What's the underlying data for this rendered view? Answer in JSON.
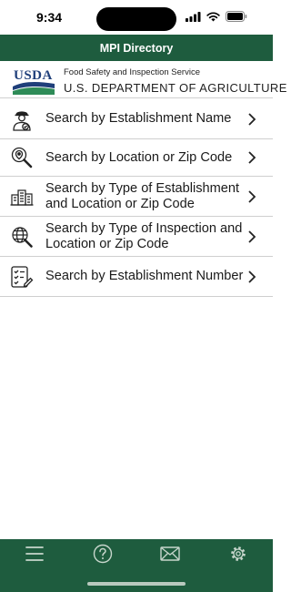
{
  "status_bar": {
    "time": "9:34"
  },
  "nav": {
    "title": "MPI Directory"
  },
  "banner": {
    "logo_text": "USDA",
    "agency": "Food Safety and Inspection Service",
    "department": "U.S. DEPARTMENT OF AGRICULTURE"
  },
  "menu": {
    "items": [
      {
        "label": "Search by Establishment Name",
        "icon": "inspector-icon"
      },
      {
        "label": "Search by Location or Zip Code",
        "icon": "location-search-icon"
      },
      {
        "label": "Search by Type of Establishment and Location or Zip Code",
        "icon": "buildings-icon"
      },
      {
        "label": "Search by Type of Inspection and Location or Zip Code",
        "icon": "globe-search-icon"
      },
      {
        "label": "Search by Establishment Number",
        "icon": "checklist-icon"
      }
    ]
  },
  "tabs": [
    "menu-icon",
    "help-icon",
    "mail-icon",
    "settings-icon"
  ],
  "colors": {
    "brand_green": "#1e5c3e",
    "text": "#1a1a1a",
    "divider": "#cfcfcf"
  }
}
